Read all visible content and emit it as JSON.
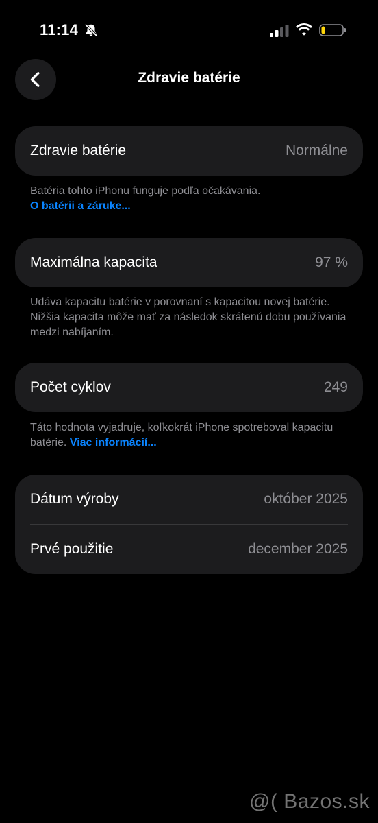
{
  "status_bar": {
    "time": "11:14",
    "icons": [
      "bell-slash-icon",
      "cellular-signal-icon",
      "wifi-icon",
      "battery-low-icon"
    ],
    "battery_color": "#ffd60a"
  },
  "nav": {
    "back_icon": "chevron-left-icon",
    "title": "Zdravie batérie"
  },
  "health": {
    "label": "Zdravie batérie",
    "value": "Normálne",
    "footnote": "Batéria tohto iPhonu funguje podľa očakávania.",
    "link": "O batérii a záruke..."
  },
  "capacity": {
    "label": "Maximálna kapacita",
    "value": "97 %",
    "footnote": "Udáva kapacitu batérie v porovnaní s kapacitou novej batérie. Nižšia kapacita môže mať za následok skrátenú dobu používania medzi nabíjaním."
  },
  "cycles": {
    "label": "Počet cyklov",
    "value": "249",
    "footnote": "Táto hodnota vyjadruje, koľkokrát iPhone spotreboval kapacitu batérie.",
    "link": "Viac informácií..."
  },
  "dates": {
    "manufacture_label": "Dátum výroby",
    "manufacture_value": "október 2025",
    "first_use_label": "Prvé použitie",
    "first_use_value": "december 2025"
  },
  "colors": {
    "background": "#000000",
    "card": "#1c1c1e",
    "secondary_text": "#8e8e93",
    "link": "#0a84ff"
  },
  "watermark": "@( Bazos.sk"
}
